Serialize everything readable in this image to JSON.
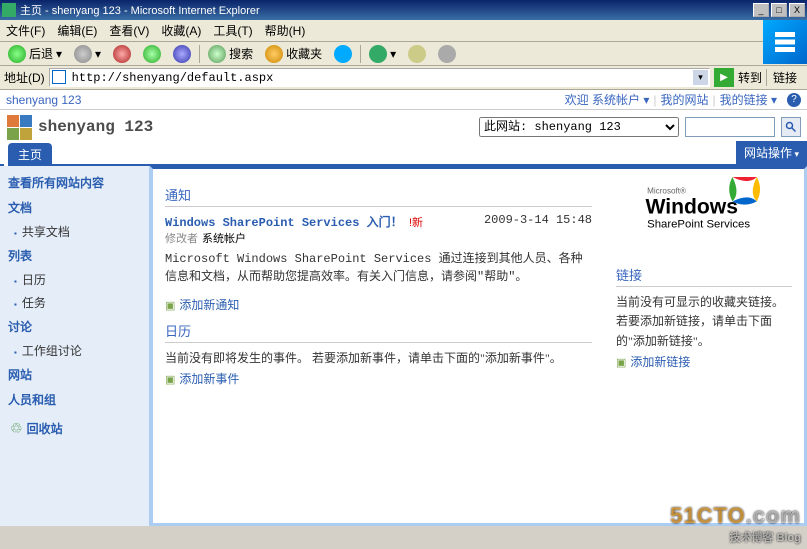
{
  "window": {
    "title": "主页 - shenyang 123 - Microsoft Internet Explorer"
  },
  "menu": {
    "file": "文件(F)",
    "edit": "编辑(E)",
    "view": "查看(V)",
    "favorites": "收藏(A)",
    "tools": "工具(T)",
    "help": "帮助(H)"
  },
  "toolbar": {
    "back": "后退",
    "search": "搜索",
    "favorites": "收藏夹"
  },
  "address": {
    "label": "地址(D)",
    "value": "http://shenyang/default.aspx",
    "go": "转到",
    "links": "链接"
  },
  "sp_top": {
    "breadcrumb": "shenyang 123",
    "welcome": "欢迎 系统帐户",
    "my_site": "我的网站",
    "my_links": "我的链接"
  },
  "sp_header": {
    "title": "shenyang 123",
    "scope_label": "此网站",
    "scope_value": "shenyang 123"
  },
  "tabs": {
    "home": "主页",
    "site_actions": "网站操作"
  },
  "quicklaunch": {
    "view_all": "查看所有网站内容",
    "docs_hdr": "文档",
    "shared_docs": "共享文档",
    "lists_hdr": "列表",
    "calendar": "日历",
    "tasks": "任务",
    "discussions_hdr": "讨论",
    "team_disc": "工作组讨论",
    "sites_hdr": "网站",
    "people_hdr": "人员和组",
    "recycle": "回收站"
  },
  "announcements": {
    "title": "通知",
    "item_title": "Windows SharePoint Services 入门！",
    "new_label": "!新",
    "date": "2009-3-14 15:48",
    "modified_by_label": "修改者",
    "modified_by": "系统帐户",
    "body": "Microsoft Windows SharePoint Services 通过连接到其他人员、各种信息和文档，从而帮助您提高效率。有关入门信息，请参阅\"帮助\"。",
    "add": "添加新通知"
  },
  "calendar_wp": {
    "title": "日历",
    "empty": "当前没有即将发生的事件。 若要添加新事件，请单击下面的\"添加新事件\"。",
    "add": "添加新事件"
  },
  "links_wp": {
    "title": "链接",
    "empty": "当前没有可显示的收藏夹链接。 若要添加新链接，请单击下面的\"添加新链接\"。",
    "add": "添加新链接"
  },
  "footer_wm": {
    "brand_pre": "51CTO",
    "brand_post": ".com",
    "sub": "技术博客    Blog"
  }
}
